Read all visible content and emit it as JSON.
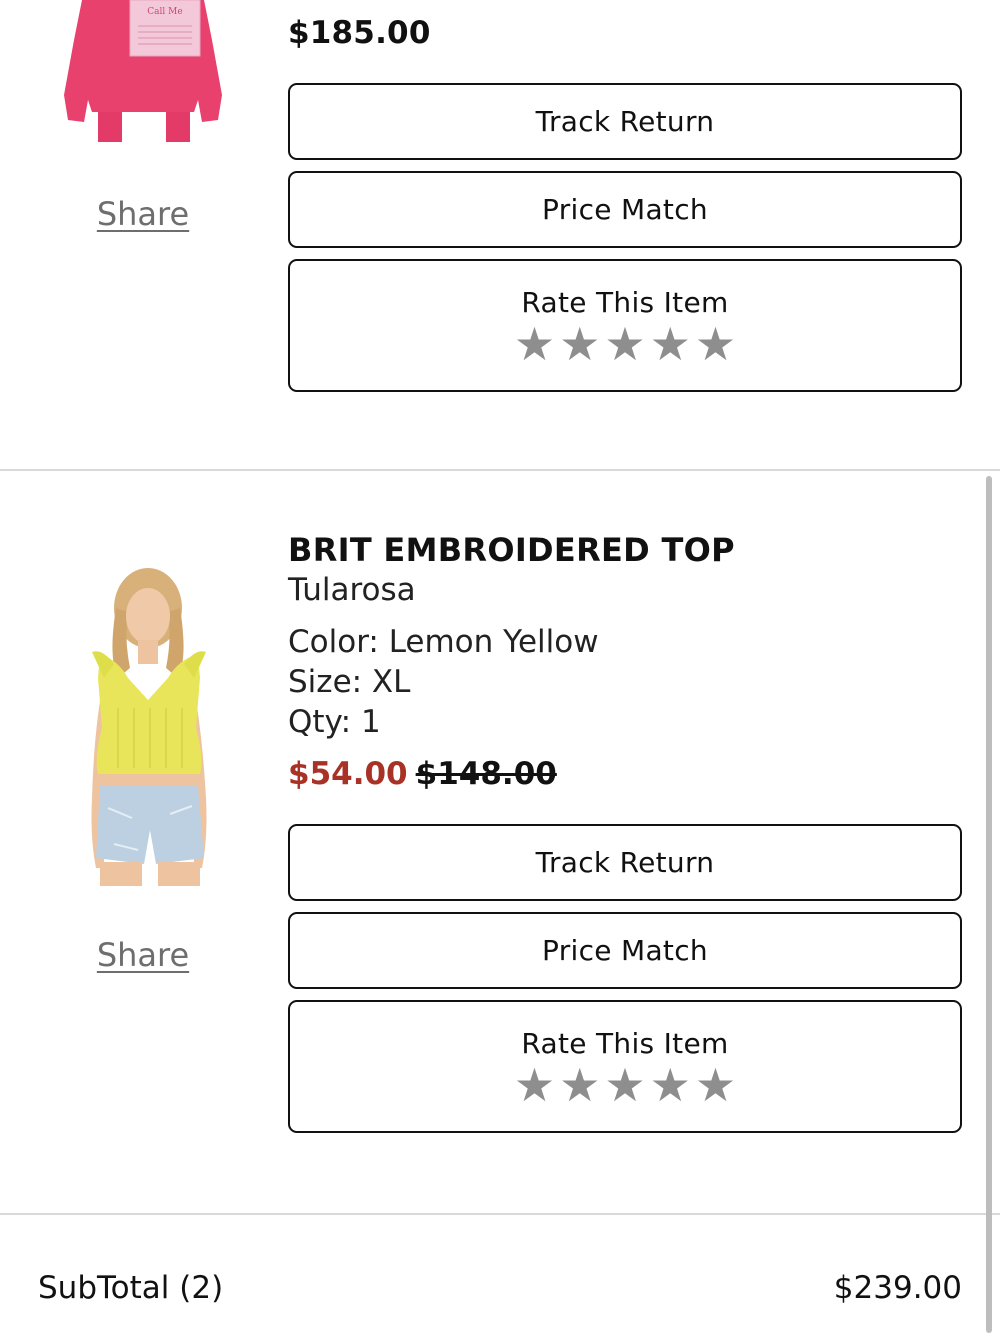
{
  "items": [
    {
      "image_alt": "Pink sweatshirt",
      "share_label": "Share",
      "price": "$185.00",
      "track_return_label": "Track Return",
      "price_match_label": "Price Match",
      "rate_label": "Rate This Item",
      "rating": 0
    },
    {
      "image_alt": "Brit Embroidered Top in Lemon Yellow",
      "share_label": "Share",
      "name": "BRIT EMBROIDERED TOP",
      "brand": "Tularosa",
      "color_line": "Color: Lemon Yellow",
      "size_line": "Size: XL",
      "qty_line": "Qty: 1",
      "sale_price": "$54.00",
      "original_price": "$148.00",
      "track_return_label": "Track Return",
      "price_match_label": "Price Match",
      "rate_label": "Rate This Item",
      "rating": 0
    }
  ],
  "star_glyph": "★",
  "star_color": "#8e8e8e",
  "sale_color": "#a83226",
  "subtotal": {
    "label": "SubTotal (2)",
    "value": "$239.00"
  }
}
